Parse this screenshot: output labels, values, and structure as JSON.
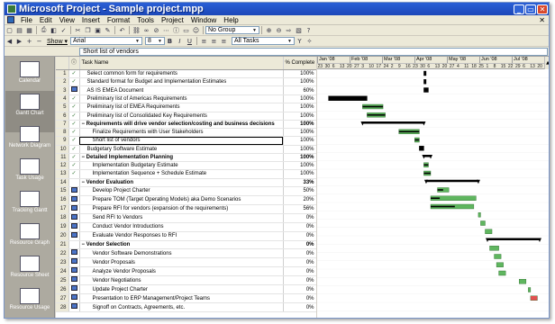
{
  "window": {
    "title": "Microsoft Project - Sample project.mpp"
  },
  "menu": [
    "File",
    "Edit",
    "View",
    "Insert",
    "Format",
    "Tools",
    "Project",
    "Window",
    "Help"
  ],
  "toolbar1": {
    "group": "No Group"
  },
  "toolbar2": {
    "show_label": "Show ▾",
    "font": "Arial",
    "size": "8",
    "filter": "All Tasks"
  },
  "entry_value": "Short list of vendors",
  "views": [
    "Calendar",
    "Gantt Chart",
    "Network Diagram",
    "Task Usage",
    "Tracking Gantt",
    "Resource Graph",
    "Resource Sheet",
    "Resource Usage"
  ],
  "columns": {
    "info": "ⓘ",
    "name": "Task Name",
    "pct": "% Complete"
  },
  "tasks": [
    {
      "id": "1",
      "ind": "check",
      "name": "Select common form for requirements",
      "pct": "100%",
      "level": 1
    },
    {
      "id": "2",
      "ind": "check",
      "name": "Standard format for Budget and Implementation Estimates",
      "pct": "100%",
      "level": 1
    },
    {
      "id": "3",
      "ind": "note",
      "name": "AS IS EMEA Document",
      "pct": "60%",
      "level": 1
    },
    {
      "id": "4",
      "ind": "check",
      "name": "Preliminary list of Americas Requirements",
      "pct": "100%",
      "level": 1
    },
    {
      "id": "5",
      "ind": "check",
      "name": "Preliminary list of EMEA Requirements",
      "pct": "100%",
      "level": 1
    },
    {
      "id": "6",
      "ind": "check",
      "name": "Preliminary list of Consolidated Key Requirements",
      "pct": "100%",
      "level": 1
    },
    {
      "id": "7",
      "ind": "check",
      "name": "Requirements will drive vendor selection/costing and business decisions",
      "pct": "100%",
      "level": 0,
      "summary": true
    },
    {
      "id": "8",
      "ind": "check",
      "name": "Finalize Requirements with User Stakeholders",
      "pct": "100%",
      "level": 2
    },
    {
      "id": "9",
      "ind": "check",
      "name": "Short list of vendors",
      "pct": "100%",
      "level": 2,
      "selected": true
    },
    {
      "id": "10",
      "ind": "check",
      "name": "Budgetary Software Estimate",
      "pct": "100%",
      "level": 1
    },
    {
      "id": "11",
      "ind": "check",
      "name": "Detailed Implementation Planning",
      "pct": "100%",
      "level": 0,
      "summary": true
    },
    {
      "id": "12",
      "ind": "check",
      "name": "Implementation Budgetary Estimate",
      "pct": "100%",
      "level": 2
    },
    {
      "id": "13",
      "ind": "check",
      "name": "Implementation Sequence + Schedule Estimate",
      "pct": "100%",
      "level": 2
    },
    {
      "id": "14",
      "ind": "",
      "name": "Vendor Evaluation",
      "pct": "33%",
      "level": 0,
      "summary": true
    },
    {
      "id": "15",
      "ind": "note",
      "name": "Develop Project Charter",
      "pct": "50%",
      "level": 2
    },
    {
      "id": "16",
      "ind": "note",
      "name": "Prepare TOM (Target Operating Models) aka Demo Scenarios",
      "pct": "20%",
      "level": 2
    },
    {
      "id": "17",
      "ind": "note",
      "name": "Prepare RFI for vendors (expansion of the requirements)",
      "pct": "56%",
      "level": 2
    },
    {
      "id": "18",
      "ind": "note",
      "name": "Send RFI to Vendors",
      "pct": "0%",
      "level": 2
    },
    {
      "id": "19",
      "ind": "note",
      "name": "Conduct Vendor Introductions",
      "pct": "0%",
      "level": 2
    },
    {
      "id": "20",
      "ind": "note",
      "name": "Evaluate Vendor Responses to RFI",
      "pct": "0%",
      "level": 2
    },
    {
      "id": "21",
      "ind": "",
      "name": "Vendor Selection",
      "pct": "0%",
      "level": 0,
      "summary": true
    },
    {
      "id": "22",
      "ind": "note",
      "name": "Vendor Software Demonstrations",
      "pct": "0%",
      "level": 2
    },
    {
      "id": "23",
      "ind": "note",
      "name": "Vendor Proposals",
      "pct": "0%",
      "level": 2
    },
    {
      "id": "24",
      "ind": "note",
      "name": "Analyze Vendor Proposals",
      "pct": "0%",
      "level": 2
    },
    {
      "id": "25",
      "ind": "note",
      "name": "Vendor Negotiations",
      "pct": "0%",
      "level": 2
    },
    {
      "id": "26",
      "ind": "note",
      "name": "Update Project Charter",
      "pct": "0%",
      "level": 2
    },
    {
      "id": "27",
      "ind": "note",
      "name": "Presentation to ERP Management/Project Teams",
      "pct": "0%",
      "level": 2
    },
    {
      "id": "28",
      "ind": "note",
      "name": "Signoff on Contracts, Agreements, etc.",
      "pct": "0%",
      "level": 2
    }
  ],
  "timescale": {
    "months": [
      "Jan '08",
      "Feb '08",
      "Mar '08",
      "Apr '08",
      "May '08",
      "Jun '08",
      "Jul '08"
    ],
    "days": [
      "23",
      "30",
      "6",
      "13",
      "20",
      "27",
      "3",
      "10",
      "17",
      "24",
      "2",
      "9",
      "16",
      "23",
      "30",
      "6",
      "13",
      "20",
      "27",
      "4",
      "11",
      "18",
      "25",
      "1",
      "8",
      "15",
      "22",
      "29",
      "6",
      "13",
      "20"
    ]
  },
  "gantt": [
    {
      "row": 1,
      "start": 0.47,
      "end": 0.48,
      "kind": "done"
    },
    {
      "row": 2,
      "start": 0.47,
      "end": 0.48,
      "kind": "done"
    },
    {
      "row": 3,
      "start": 0.47,
      "end": 0.49,
      "kind": "done"
    },
    {
      "row": 4,
      "start": 0.05,
      "end": 0.22,
      "kind": "done"
    },
    {
      "row": 5,
      "start": 0.2,
      "end": 0.29,
      "kind": "progress",
      "pct": 100
    },
    {
      "row": 6,
      "start": 0.22,
      "end": 0.3,
      "kind": "progress",
      "pct": 100
    },
    {
      "row": 7,
      "start": 0.2,
      "end": 0.47,
      "kind": "summary"
    },
    {
      "row": 8,
      "start": 0.36,
      "end": 0.45,
      "kind": "progress",
      "pct": 100
    },
    {
      "row": 9,
      "start": 0.43,
      "end": 0.45,
      "kind": "progress",
      "pct": 100
    },
    {
      "row": 10,
      "start": 0.45,
      "end": 0.47,
      "kind": "done"
    },
    {
      "row": 11,
      "start": 0.47,
      "end": 0.5,
      "kind": "summary"
    },
    {
      "row": 12,
      "start": 0.47,
      "end": 0.49,
      "kind": "progress",
      "pct": 100
    },
    {
      "row": 13,
      "start": 0.47,
      "end": 0.5,
      "kind": "progress",
      "pct": 100
    },
    {
      "row": 14,
      "start": 0.48,
      "end": 0.71,
      "kind": "summary"
    },
    {
      "row": 15,
      "start": 0.53,
      "end": 0.58,
      "kind": "progress",
      "pct": 50
    },
    {
      "row": 16,
      "start": 0.5,
      "end": 0.7,
      "kind": "progress",
      "pct": 20
    },
    {
      "row": 17,
      "start": 0.5,
      "end": 0.69,
      "kind": "progress",
      "pct": 56
    },
    {
      "row": 18,
      "start": 0.71,
      "end": 0.72,
      "kind": "task"
    },
    {
      "row": 19,
      "start": 0.72,
      "end": 0.74,
      "kind": "task"
    },
    {
      "row": 20,
      "start": 0.74,
      "end": 0.77,
      "kind": "task"
    },
    {
      "row": 21,
      "start": 0.75,
      "end": 0.98,
      "kind": "summary"
    },
    {
      "row": 22,
      "start": 0.76,
      "end": 0.8,
      "kind": "task"
    },
    {
      "row": 23,
      "start": 0.78,
      "end": 0.81,
      "kind": "task"
    },
    {
      "row": 24,
      "start": 0.79,
      "end": 0.82,
      "kind": "task"
    },
    {
      "row": 25,
      "start": 0.8,
      "end": 0.83,
      "kind": "task"
    },
    {
      "row": 26,
      "start": 0.89,
      "end": 0.92,
      "kind": "task"
    },
    {
      "row": 27,
      "start": 0.93,
      "end": 0.94,
      "kind": "task"
    },
    {
      "row": 28,
      "start": 0.94,
      "end": 0.97,
      "kind": "critical"
    }
  ],
  "colors": {
    "done": "#000000",
    "task": "#5fb65f",
    "summary": "#000000",
    "critical": "#e35050"
  }
}
